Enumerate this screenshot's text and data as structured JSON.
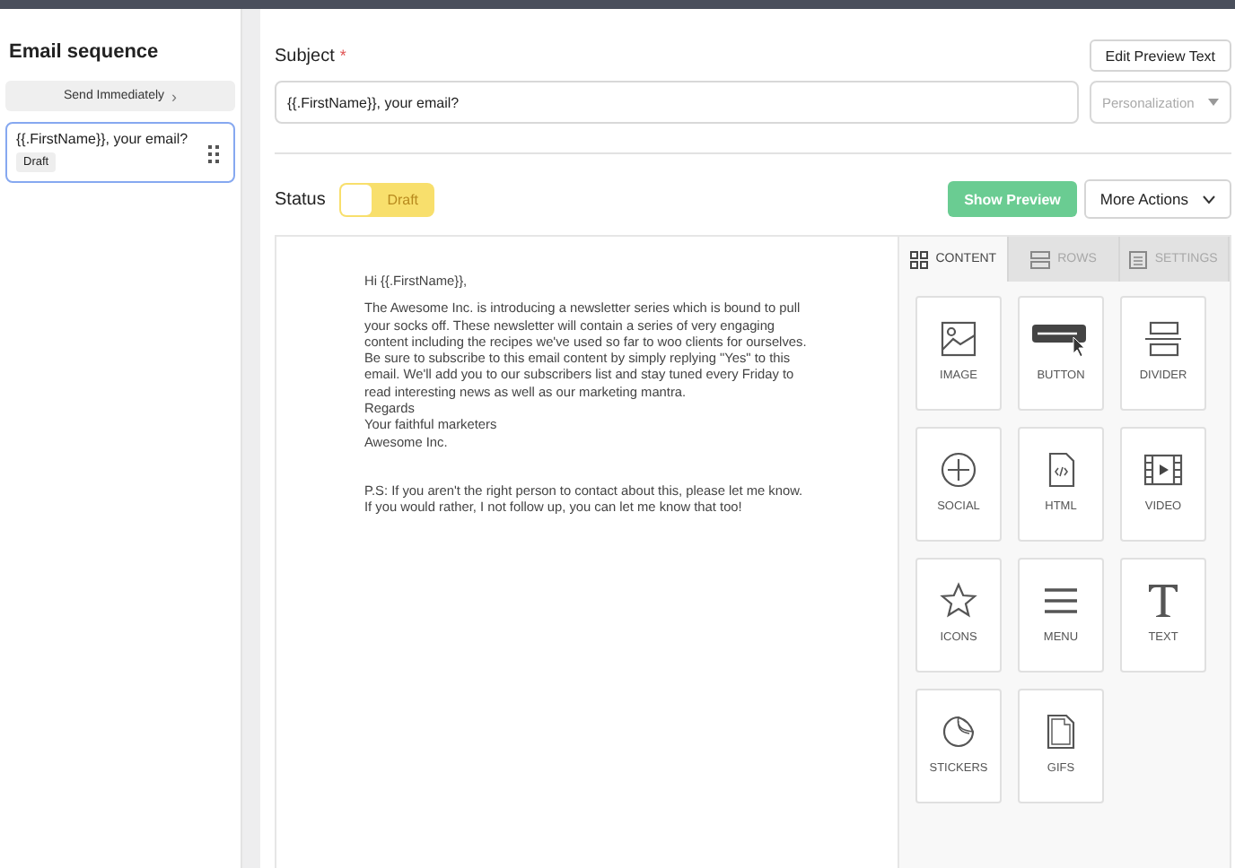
{
  "sidebar": {
    "title": "Email sequence",
    "trigger": "Send Immediately",
    "trigger_icon": "›",
    "emails": [
      {
        "subject": "{{.FirstName}}, your email?",
        "status": "Draft",
        "selected": true
      }
    ]
  },
  "subject": {
    "label": "Subject",
    "required": "*",
    "value": "{{.FirstName}}, your email?",
    "edit_preview_button": "Edit Preview Text",
    "personalization": {
      "placeholder": "Personalization"
    }
  },
  "status": {
    "label": "Status",
    "toggle": {
      "on": false,
      "text": "Draft"
    },
    "show_preview": "Show Preview",
    "more_actions": "More Actions"
  },
  "email": {
    "paragraphs": [
      {
        "kind": "normal",
        "lines": [
          "Hi {{.FirstName}},"
        ]
      },
      {
        "kind": "normal",
        "lines": [
          "The Awesome Inc. is introducing a newsletter series which is bound to pull your socks off. These newsletter will contain a series of very engaging content including the recipes we've used so far to woo clients for ourselves. Be sure to subscribe to this email content by simply replying \"Yes\" to this email. We'll add you to our subscribers list and stay tuned every Friday to read interesting news as well as our marketing mantra.",
          "Regards",
          "Your faithful marketers",
          "Awesome Inc."
        ]
      },
      {
        "kind": "postscript",
        "lines": [
          "P.S: If you aren't the right person to contact about this, please let me know. If you would rather, I not follow up, you can let me know that too!"
        ]
      }
    ]
  },
  "panel": {
    "tabs": [
      {
        "label": "CONTENT",
        "kind": "content",
        "selected": true
      },
      {
        "label": "ROWS",
        "kind": "rows",
        "selected": false
      },
      {
        "label": "SETTINGS",
        "kind": "settings",
        "selected": false
      }
    ],
    "tiles": [
      {
        "label": "IMAGE",
        "kind": "image"
      },
      {
        "label": "BUTTON",
        "kind": "button"
      },
      {
        "label": "DIVIDER",
        "kind": "divider"
      },
      {
        "label": "SOCIAL",
        "kind": "social"
      },
      {
        "label": "HTML",
        "kind": "html"
      },
      {
        "label": "VIDEO",
        "kind": "video"
      },
      {
        "label": "ICONS",
        "kind": "icons"
      },
      {
        "label": "MENU",
        "kind": "menu"
      },
      {
        "label": "TEXT",
        "kind": "text"
      },
      {
        "label": "STICKERS",
        "kind": "stickers"
      },
      {
        "label": "GIFS",
        "kind": "gifs"
      }
    ]
  }
}
